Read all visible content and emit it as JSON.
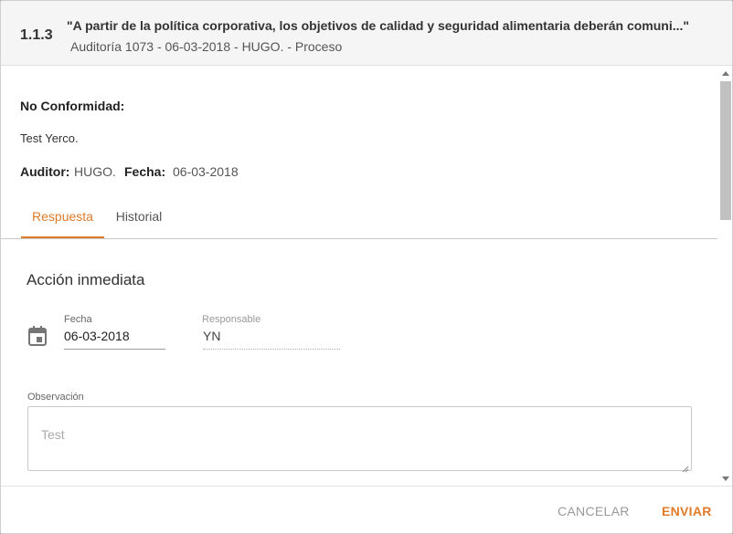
{
  "header": {
    "code": "1.1.3",
    "title": "\"A partir de la política corporativa, los objetivos de calidad y seguridad alimentaria deberán comuni...\"",
    "subtitle": "Auditoría 1073 - 06-03-2018 - HUGO. - Proceso"
  },
  "nonconformity": {
    "label": "No Conformidad:",
    "text": "Test Yerco.",
    "auditor_label": "Auditor:",
    "auditor_value": "HUGO.",
    "date_label": "Fecha:",
    "date_value": "06-03-2018"
  },
  "tabs": [
    {
      "label": "Respuesta",
      "active": true
    },
    {
      "label": "Historial",
      "active": false
    }
  ],
  "form": {
    "section_title": "Acción inmediata",
    "fecha_label": "Fecha",
    "fecha_value": "06-03-2018",
    "responsable_label": "Responsable",
    "responsable_value": "YN",
    "observacion_label": "Observación",
    "observacion_placeholder": "Test"
  },
  "footer": {
    "cancel_label": "CANCELAR",
    "send_label": "ENVIAR"
  },
  "colors": {
    "accent": "#e07b2a"
  },
  "icons": {
    "date": "calendar-icon"
  }
}
